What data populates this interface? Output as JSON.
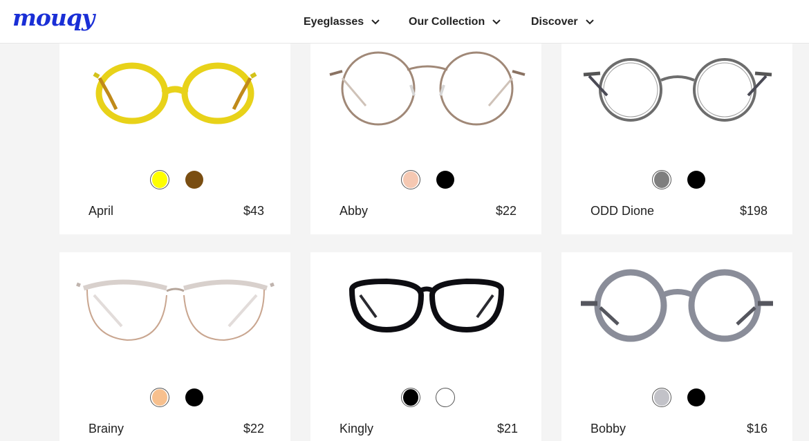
{
  "header": {
    "logo": "mouqy",
    "nav": [
      {
        "label": "Eyeglasses"
      },
      {
        "label": "Our Collection"
      },
      {
        "label": "Discover"
      }
    ]
  },
  "products": [
    {
      "name": "April",
      "price": "$43",
      "colors": [
        "#ffff00",
        "#7a4e12"
      ],
      "frame": "yellow-round-frame"
    },
    {
      "name": "Abby",
      "price": "$22",
      "colors": [
        "#f5c8b2",
        "#000000"
      ],
      "frame": "rose-gold-round-wire-frame"
    },
    {
      "name": "ODD Dione",
      "price": "$198",
      "colors": [
        "#7f7f7f",
        "#000000"
      ],
      "frame": "gunmetal-round-wire-frame"
    },
    {
      "name": "Brainy",
      "price": "$22",
      "colors": [
        "#f7c08e",
        "#000000"
      ],
      "frame": "clear-browline-frame"
    },
    {
      "name": "Kingly",
      "price": "$21",
      "colors": [
        "#000000",
        "#ffffff"
      ],
      "frame": "black-round-frame"
    },
    {
      "name": "Bobby",
      "price": "$16",
      "colors": [
        "#c2c2c8",
        "#000000"
      ],
      "frame": "grey-translucent-round-frame"
    }
  ]
}
